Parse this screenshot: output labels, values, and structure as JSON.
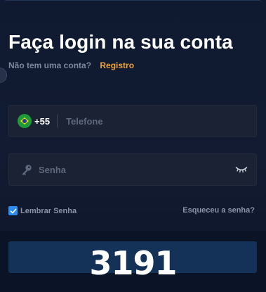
{
  "login": {
    "title": "Faça login na sua conta",
    "subtitle": "Não tem uma conta?",
    "register_link": "Registro",
    "phone": {
      "country_code": "+55",
      "flag_icon": "brazil-flag-icon",
      "placeholder": "Telefone",
      "value": ""
    },
    "password": {
      "placeholder": "Senha",
      "value": "",
      "key_icon": "key-icon",
      "visibility_icon": "eye-closed-icon"
    },
    "remember_label": "Lembrar Senha",
    "remember_checked": true,
    "forgot_link": "Esqueceu a senha?",
    "captcha_code": "3191"
  },
  "colors": {
    "background": "#10192e",
    "accent": "#f2a33a",
    "checkbox": "#2d8cf0",
    "button": "#143257"
  }
}
